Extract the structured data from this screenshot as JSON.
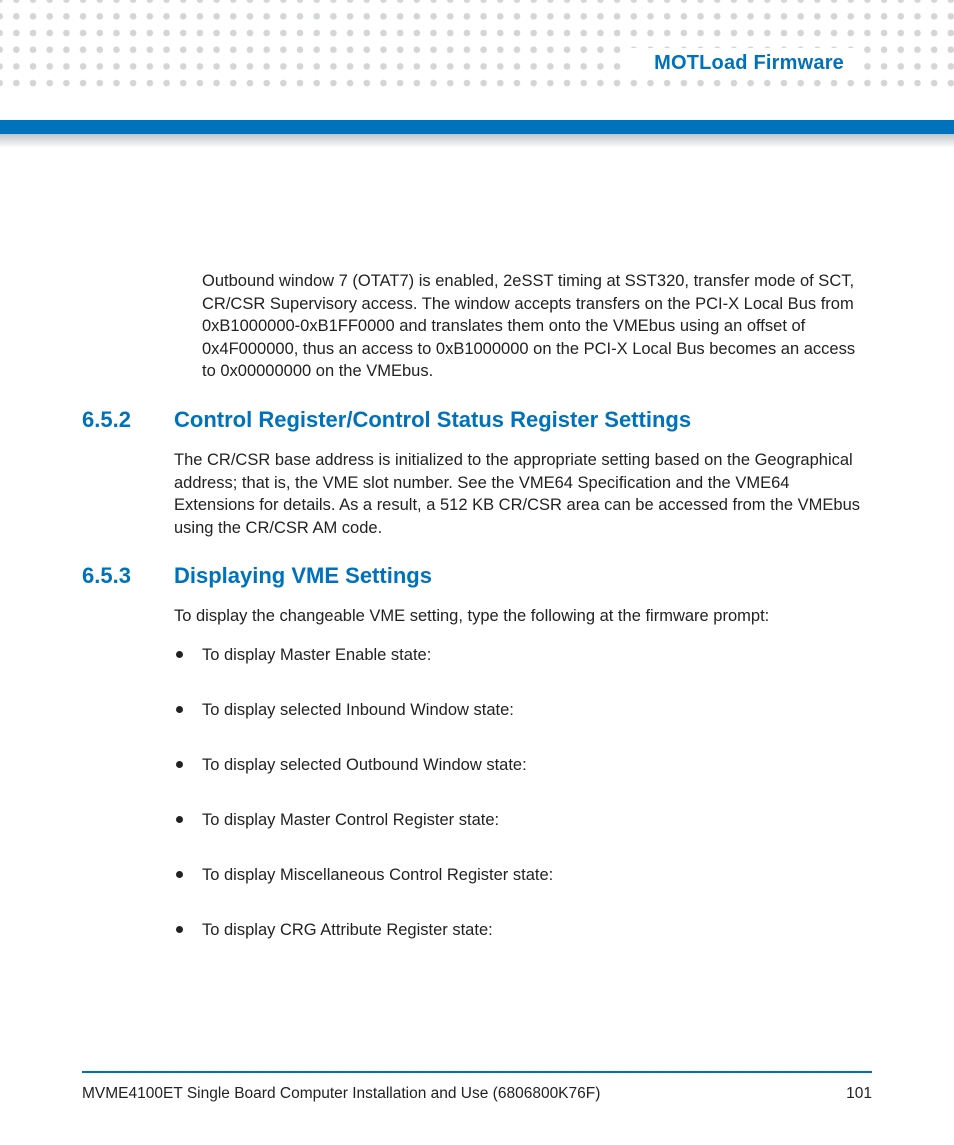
{
  "header": {
    "chapter_title": "MOTLoad Firmware"
  },
  "intro_paragraph": "Outbound window 7 (OTAT7) is enabled, 2eSST timing at SST320, transfer mode of SCT, CR/CSR Supervisory access. The window accepts transfers on the PCI-X Local Bus from 0xB1000000-0xB1FF0000 and translates them onto the VMEbus using an offset of 0x4F000000, thus an access to 0xB1000000 on the PCI-X Local Bus becomes an access to 0x00000000 on the VMEbus.",
  "sections": [
    {
      "number": "6.5.2",
      "title": "Control Register/Control Status Register Settings",
      "paragraph": "The CR/CSR base address is initialized to the appropriate setting based on the Geographical address; that is, the VME slot number. See the VME64 Specification and the VME64 Extensions for details. As a result, a 512 KB CR/CSR area can be accessed from the VMEbus using the CR/CSR AM code."
    },
    {
      "number": "6.5.3",
      "title": "Displaying VME Settings",
      "paragraph": "To display the changeable VME setting, type the following at the firmware prompt:",
      "bullets": [
        "To display Master Enable state:",
        "To display selected Inbound Window state:",
        "To display selected Outbound Window state:",
        "To display Master Control Register state:",
        "To display Miscellaneous Control Register state:",
        "To display CRG Attribute Register state:"
      ]
    }
  ],
  "footer": {
    "doc_title": "MVME4100ET Single Board Computer Installation and Use (6806800K76F)",
    "page_number": "101"
  }
}
